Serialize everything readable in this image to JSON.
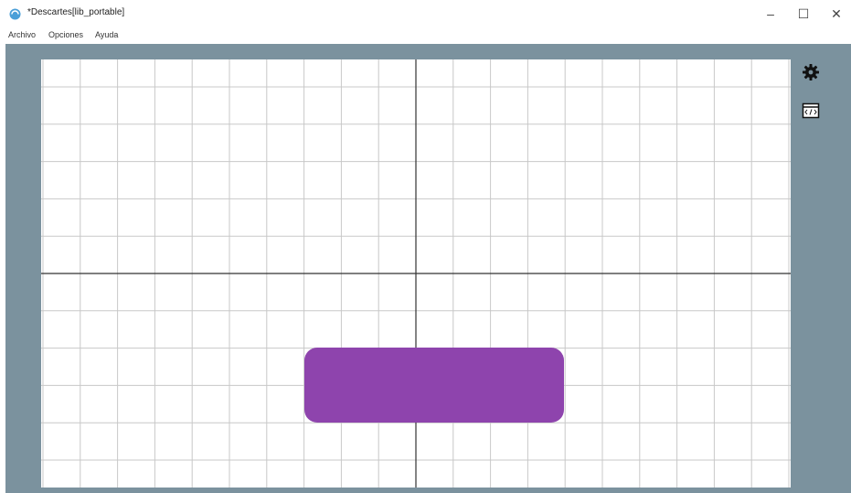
{
  "window": {
    "title": "*Descartes[lib_portable]",
    "minimize_glyph": "–",
    "maximize_glyph": "☐",
    "close_glyph": "✕"
  },
  "menu": {
    "items": [
      {
        "label": "Archivo"
      },
      {
        "label": "Opciones"
      },
      {
        "label": "Ayuda"
      }
    ]
  },
  "toolbar": {
    "config_icon": "gear-icon",
    "code_icon": "code-window-icon"
  },
  "colors": {
    "workspace_bg": "#7b929e",
    "canvas_bg": "#ffffff",
    "grid_line": "#c8c8c8",
    "axis_line": "#333333",
    "shape_fill": "#8e44ad",
    "app_icon": "#4a9fd8"
  }
}
